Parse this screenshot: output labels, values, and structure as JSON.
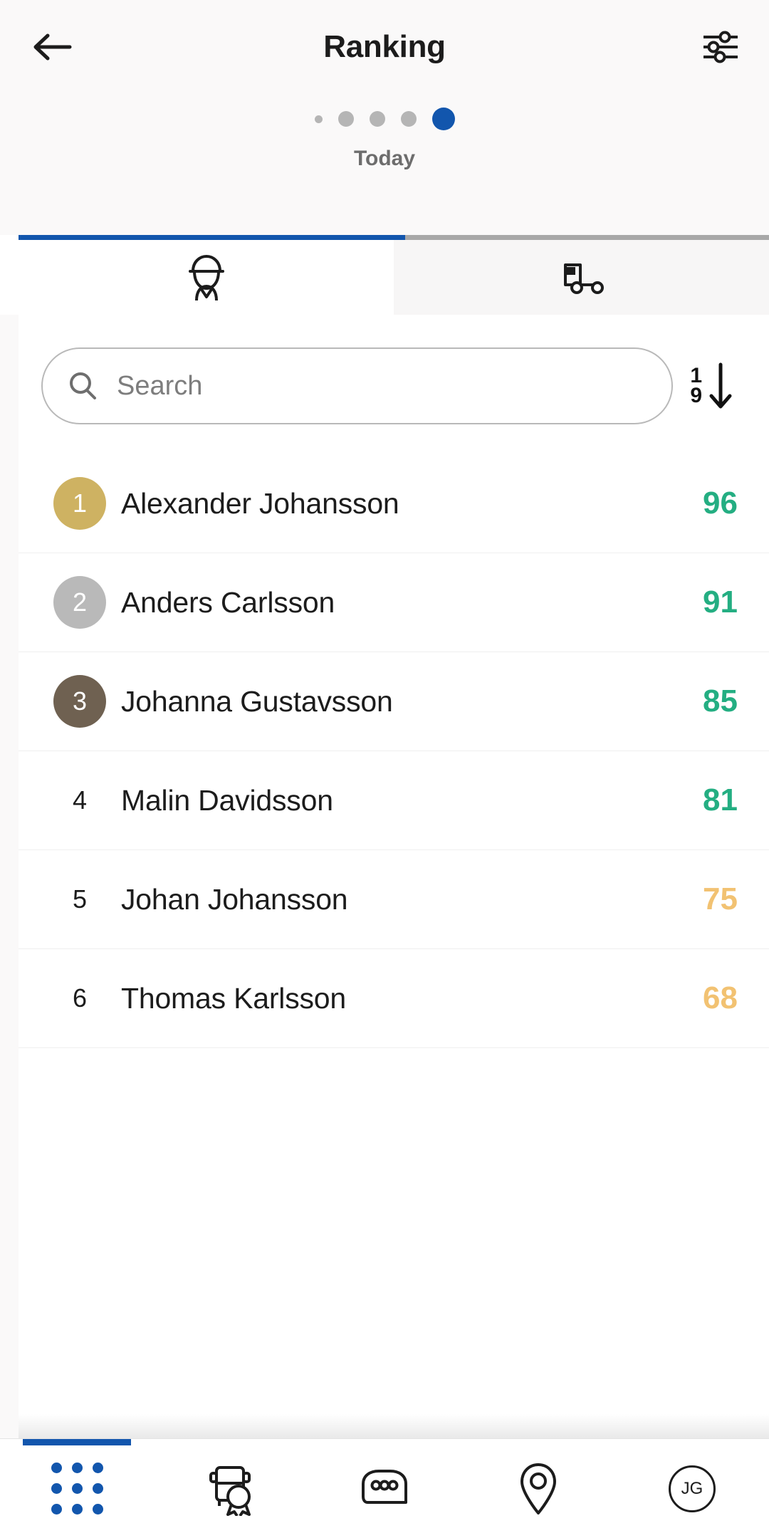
{
  "header": {
    "back_icon": "arrow-left-icon",
    "title": "Ranking",
    "filter_icon": "sliders-filter-icon",
    "pagination": {
      "dots": [
        "tiny",
        "small",
        "small",
        "small",
        "active"
      ],
      "active_index": 4,
      "active_color": "#1256ad",
      "inactive_color": "#b5b5b5"
    },
    "period_label": "Today"
  },
  "tabs": {
    "progress_fill_color": "#1256ad",
    "progress_track_color": "#a8a8a8",
    "items": [
      {
        "name": "driver-tab",
        "icon": "driver-cap-person-icon",
        "active": true
      },
      {
        "name": "vehicle-tab",
        "icon": "truck-side-icon",
        "active": false
      }
    ]
  },
  "search": {
    "icon": "search-icon",
    "placeholder": "Search",
    "value": ""
  },
  "sort": {
    "name": "sort-descending-button",
    "top_label": "1",
    "bottom_label": "9",
    "arrow_icon": "arrow-down-icon"
  },
  "colors": {
    "gold": "#ceb262",
    "silver": "#b9b9b9",
    "bronze": "#6f6151",
    "score_green": "#24ae82",
    "score_amber": "#f2c272",
    "accent_blue": "#1256ad"
  },
  "ranking": {
    "rows": [
      {
        "rank": "1",
        "name": "Alexander Johansson",
        "score": "96",
        "badge": "gold",
        "score_color": "#24ae82"
      },
      {
        "rank": "2",
        "name": "Anders Carlsson",
        "score": "91",
        "badge": "silver",
        "score_color": "#24ae82"
      },
      {
        "rank": "3",
        "name": "Johanna Gustavsson",
        "score": "85",
        "badge": "bronze",
        "score_color": "#24ae82"
      },
      {
        "rank": "4",
        "name": "Malin Davidsson",
        "score": "81",
        "badge": "none",
        "score_color": "#24ae82"
      },
      {
        "rank": "5",
        "name": "Johan Johansson",
        "score": "75",
        "badge": "none",
        "score_color": "#f2c272"
      },
      {
        "rank": "6",
        "name": "Thomas Karlsson",
        "score": "68",
        "badge": "none",
        "score_color": "#f2c272"
      }
    ]
  },
  "bottom_nav": {
    "items": [
      {
        "name": "nav-dashboard",
        "icon": "grid-dots-icon",
        "active": true,
        "label": ""
      },
      {
        "name": "nav-vehicles",
        "icon": "truck-award-icon",
        "active": false,
        "label": ""
      },
      {
        "name": "nav-messages",
        "icon": "chat-bubble-icon",
        "active": false,
        "label": ""
      },
      {
        "name": "nav-map",
        "icon": "location-pin-icon",
        "active": false,
        "label": ""
      },
      {
        "name": "nav-profile",
        "icon": "avatar-initials-icon",
        "active": false,
        "label": "JG"
      }
    ]
  }
}
